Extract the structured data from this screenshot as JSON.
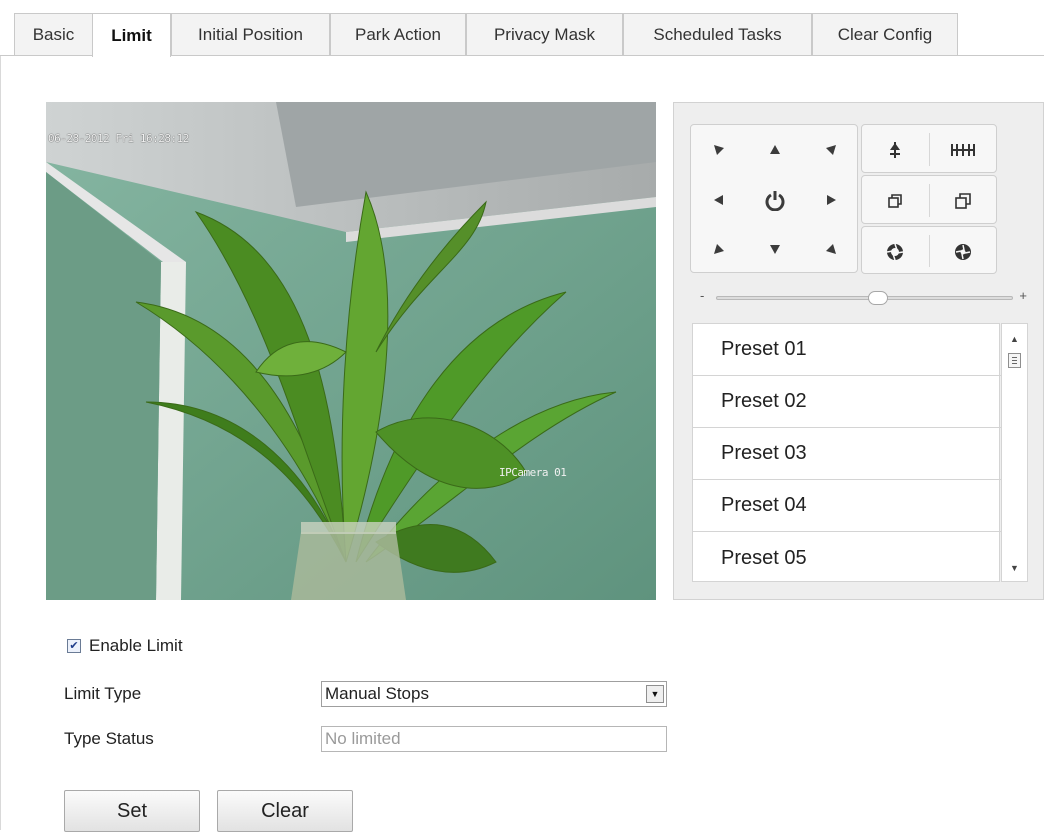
{
  "tabs": [
    {
      "label": "Basic",
      "active": false
    },
    {
      "label": "Limit",
      "active": true
    },
    {
      "label": "Initial Position",
      "active": false
    },
    {
      "label": "Park Action",
      "active": false
    },
    {
      "label": "Privacy Mask",
      "active": false
    },
    {
      "label": "Scheduled Tasks",
      "active": false
    },
    {
      "label": "Clear Config",
      "active": false
    }
  ],
  "video": {
    "timestamp": "06-28-2012 Fri 16:28:12",
    "camera_name": "IPCamera 01"
  },
  "ptz": {
    "direction_icons": [
      "arrow-up-left-icon",
      "arrow-up-icon",
      "arrow-up-right-icon",
      "arrow-left-icon",
      "auto-scan-icon",
      "arrow-right-icon",
      "arrow-down-left-icon",
      "arrow-down-icon",
      "arrow-down-right-icon"
    ],
    "control_icons": [
      "zoom-in-icon",
      "zoom-out-icon",
      "focus-near-icon",
      "focus-far-icon",
      "iris-open-icon",
      "iris-close-icon"
    ],
    "speed_slider": {
      "minus": "-",
      "plus": "+",
      "level": 0.55
    },
    "presets": [
      "Preset 01",
      "Preset 02",
      "Preset 03",
      "Preset 04",
      "Preset 05"
    ]
  },
  "form": {
    "enable_limit_label": "Enable Limit",
    "enable_limit_checked": true,
    "limit_type_label": "Limit Type",
    "limit_type_value": "Manual Stops",
    "type_status_label": "Type Status",
    "type_status_value": "No limited"
  },
  "buttons": {
    "set": "Set",
    "clear": "Clear"
  }
}
